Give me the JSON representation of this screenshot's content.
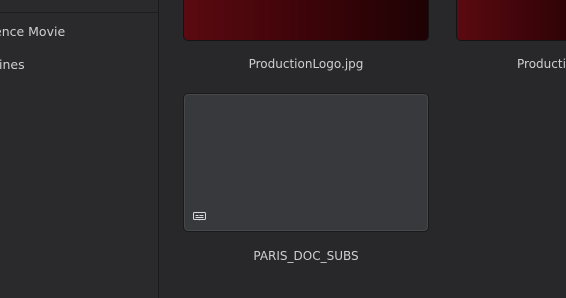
{
  "sidebar": {
    "items": [
      {
        "label": "ence Movie"
      },
      {
        "label": "ines"
      }
    ]
  },
  "media_pool": {
    "clips": [
      {
        "name": "ProductionLogo.jpg",
        "kind": "image"
      },
      {
        "name": "Producti",
        "kind": "image"
      },
      {
        "name": "PARIS_DOC_SUBS",
        "kind": "subtitle",
        "icon": "subtitle-icon"
      }
    ]
  },
  "colors": {
    "background": "#28282b",
    "thumbnail_red": "#5a0a10",
    "thumbnail_gray": "#38393d",
    "text": "#cfcfcf"
  }
}
